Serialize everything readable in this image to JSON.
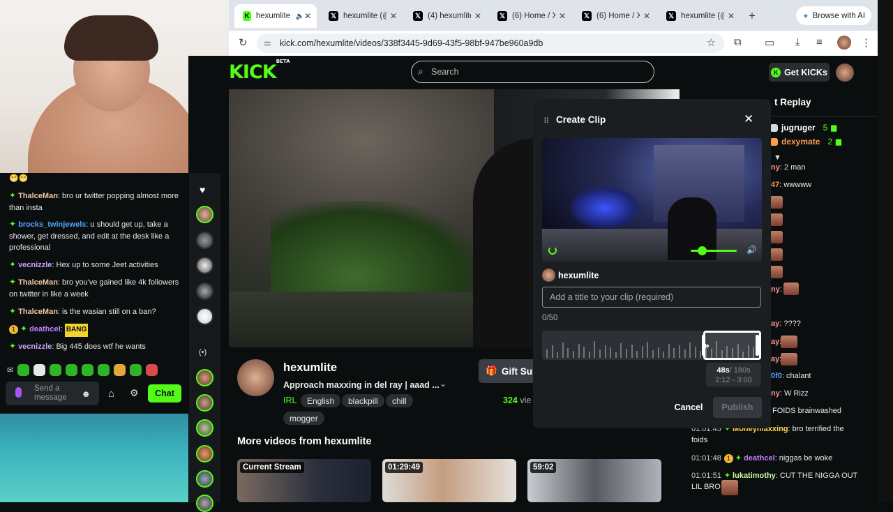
{
  "browser": {
    "tabs": [
      {
        "label": "hexumlite",
        "icon": "kick-icon",
        "active": true
      },
      {
        "label": "hexumlite (@",
        "icon": "x-icon"
      },
      {
        "label": "(4) hexumlite",
        "icon": "x-icon"
      },
      {
        "label": "(6) Home / X",
        "icon": "x-icon"
      },
      {
        "label": "(6) Home / X",
        "icon": "x-icon"
      },
      {
        "label": "hexumlite (@",
        "icon": "x-icon"
      }
    ],
    "browse_ai": "Browse with AI",
    "url": "kick.com/hexumlite/videos/338f3445-9d69-43f5-98bf-947be960a9db"
  },
  "kick": {
    "logo": "KICK",
    "logo_sup": "BETA",
    "search_placeholder": "Search",
    "get_kicks": "Get KICKs",
    "accent": "#53fc18"
  },
  "webcam_chat": {
    "top_emotes": "😁😁",
    "messages": [
      {
        "user": "ThalceMan",
        "text": "bro ur twitter popping almost more than insta",
        "color": "#f4c8a4"
      },
      {
        "user": "brocks_twinjewels",
        "text": "u should get up, take a shower, get dressed, and edit at the desk like a professional",
        "color": "#4fa3ff"
      },
      {
        "user": "vecnizzle",
        "text": "Hex up to some Jeet activities",
        "color": "#c9a4ff"
      },
      {
        "user": "ThalceMan",
        "text": "bro you've gained like 4k followers on twitter in like a week",
        "color": "#f4c8a4"
      },
      {
        "user": "ThalceMan",
        "text": "is the wasian still on a ban?",
        "color": "#f4c8a4"
      },
      {
        "user": "deathcel",
        "text": "BANG",
        "color": "#c07cff",
        "level": "1"
      },
      {
        "user": "vecnizzle",
        "text": "Big 445 does wtf he wants",
        "color": "#c9a4ff"
      }
    ],
    "send_placeholder": "Send a message",
    "chat_button": "Chat"
  },
  "stream": {
    "streamer": "hexumlite",
    "title": "Approach maxxing in del ray | aaad ...",
    "category": "IRL",
    "tags": [
      "English",
      "blackpill",
      "chill",
      "mogger"
    ],
    "gift_subs": "Gift Sub",
    "viewers": "324",
    "viewers_suffix": "vie",
    "more_videos": "More videos from hexumlite",
    "thumbnails": [
      {
        "label": "Current Stream"
      },
      {
        "label": "01:29:49"
      },
      {
        "label": "59:02"
      }
    ]
  },
  "replay": {
    "title": "t Replay",
    "leaders": [
      {
        "user": "jugruger",
        "count": "5",
        "color": "#ffffff"
      },
      {
        "user": "dexymate",
        "count": "2",
        "color": "#ff9b4a"
      }
    ],
    "partial": [
      {
        "user": "ny",
        "text": ": 2 man",
        "color": "#ff8f8f"
      },
      {
        "user": "47",
        "text": ": wwwww",
        "color": "#ff9b4a"
      },
      {
        "user": "ny",
        "text": ":",
        "color": "#ff8f8f"
      },
      {
        "user": "ay",
        "text": ": ????",
        "color": "#ff8f8f"
      },
      {
        "user": "ay",
        "text": ":",
        "color": "#ff8f8f"
      },
      {
        "user": "ay",
        "text": ":",
        "color": "#ff8f8f"
      },
      {
        "user": "0f0",
        "text": ": chalant",
        "color": "#4fa3ff"
      },
      {
        "user": "ny",
        "text": ": W Rizz",
        "color": "#ff8f8f"
      },
      {
        "user": "",
        "text": "FOIDS brainwashed",
        "color": "#ffffff"
      }
    ],
    "full": [
      {
        "time": "01:01:45",
        "user": "Moneymaxxing",
        "text": ": bro terrified the foids",
        "color": "#ffd54a"
      },
      {
        "time": "01:01:48",
        "user": "deathcel",
        "text": ": niggas be woke",
        "color": "#c07cff",
        "level": "1"
      },
      {
        "time": "01:01:51",
        "user": "lukatimothy",
        "text": ": CUT THE NIGGA OUT LIL BRO",
        "color": "#c9ff9a"
      }
    ]
  },
  "clip": {
    "title": "Create Clip",
    "author": "hexumlite",
    "input_placeholder": "Add a title to your clip (required)",
    "counter": "0/50",
    "duration": "48s",
    "duration_max": "/ 180s",
    "range": "2:12 - 3:00",
    "cancel": "Cancel",
    "publish": "Publish",
    "volume_level": 0.15,
    "selection_start_fraction": 0.74,
    "selection_end_fraction": 1.0
  }
}
